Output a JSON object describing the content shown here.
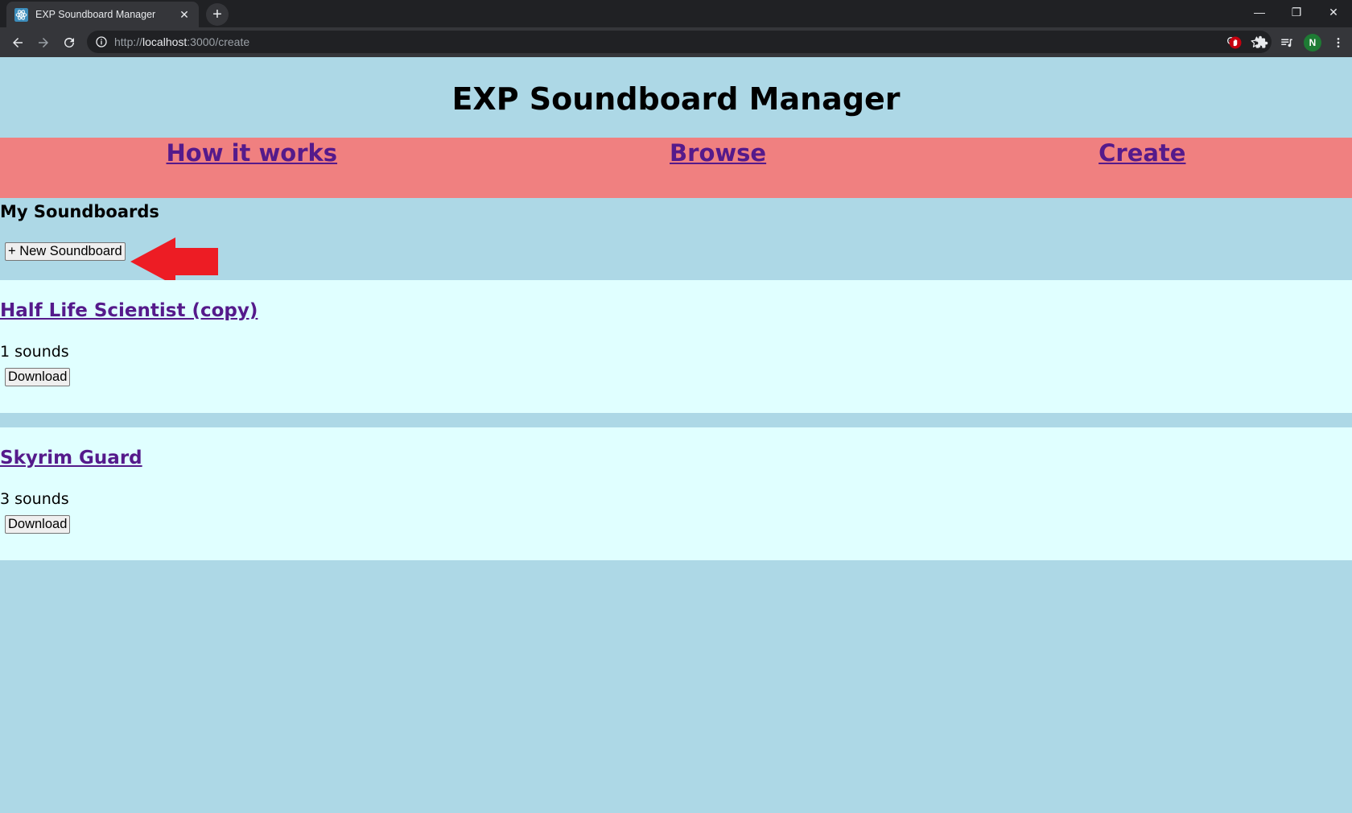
{
  "browser": {
    "tab_title": "EXP Soundboard Manager",
    "url_scheme": "http://",
    "url_host": "localhost",
    "url_path": ":3000/create",
    "avatar_letter": "N"
  },
  "page": {
    "title": "EXP Soundboard Manager",
    "nav": {
      "how": "How it works",
      "browse": "Browse",
      "create": "Create"
    },
    "section_title": "My Soundboards",
    "new_button": "+ New Soundboard",
    "soundboards": [
      {
        "title": "Half Life Scientist (copy)",
        "count": "1 sounds",
        "download": "Download"
      },
      {
        "title": "Skyrim Guard",
        "count": "3 sounds",
        "download": "Download"
      }
    ]
  },
  "colors": {
    "background": "#add8e6",
    "nav_bg": "#f08080",
    "card_bg": "#e0ffff",
    "link": "#551a8b",
    "arrow": "#ed1c24"
  }
}
